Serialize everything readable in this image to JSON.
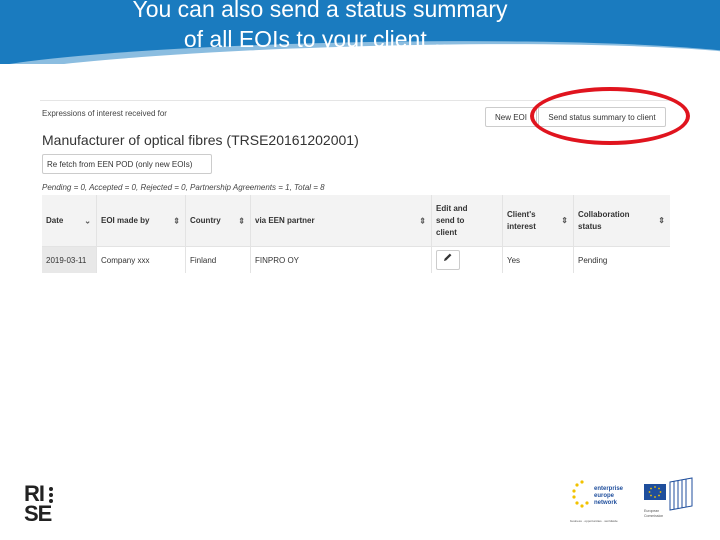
{
  "slide": {
    "title_line1": "You can also send a status summary",
    "title_line2": "of all EOIs to your client …",
    "header_color": "#1a7bbf",
    "highlight_color": "#e0141e"
  },
  "app": {
    "expressions_label": "Expressions of interest received for",
    "new_eoi_button": "New EOI",
    "send_summary_button": "Send status summary to client",
    "profile_title": "Manufacturer of optical fibres (TRSE20161202001)",
    "refetch_button": "Re fetch from EEN POD (only new EOIs)",
    "summary": "Pending = 0, Accepted = 0, Rejected = 0, Partnership Agreements = 1, Total = 8",
    "table": {
      "headers": {
        "date": "Date",
        "eoi_made_by": "EOI made by",
        "country": "Country",
        "via_partner": "via EEN partner",
        "edit_send_1": "Edit and",
        "edit_send_2": "send to",
        "edit_send_3": "client",
        "client_interest_1": "Client's",
        "client_interest_2": "interest",
        "collab_1": "Collaboration",
        "collab_2": "status"
      },
      "rows": [
        {
          "date": "2019-03-11",
          "eoi_made_by": "Company xxx",
          "country": "Finland",
          "via_partner": "FINPRO OY",
          "client_interest": "Yes",
          "collaboration_status": "Pending"
        }
      ]
    }
  },
  "footer": {
    "rise_line1": "RI",
    "rise_line2": "SE",
    "een_line1": "enterprise",
    "een_line2": "europe",
    "een_line3": "network",
    "een_tagline": "business · opportunities · worldwide",
    "ec_label1": "European",
    "ec_label2": "Commission"
  }
}
